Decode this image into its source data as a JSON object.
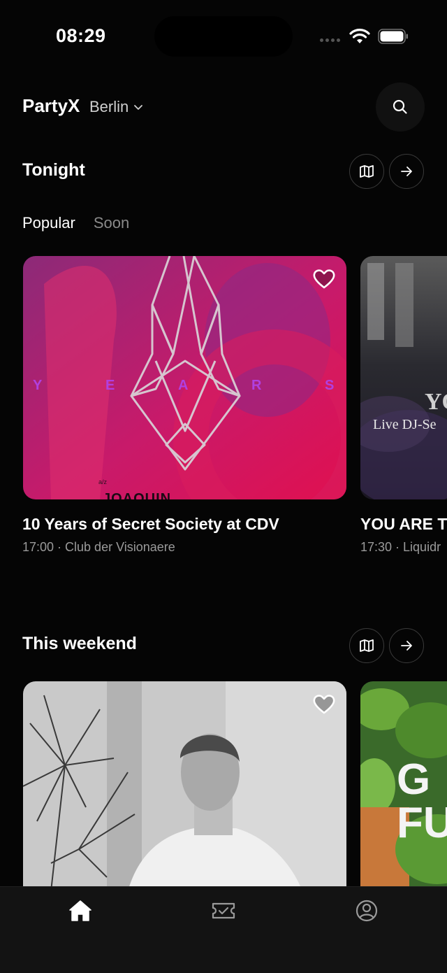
{
  "status_bar": {
    "time": "08:29"
  },
  "header": {
    "app_name": "PartyX",
    "city": "Berlin"
  },
  "sections": [
    {
      "title": "Tonight",
      "tabs": [
        {
          "label": "Popular",
          "active": true
        },
        {
          "label": "Soon",
          "active": false
        }
      ],
      "events": [
        {
          "title": "10 Years of Secret Society at CDV",
          "meta": "17:00 · Club der Visionaere",
          "poster_letters": [
            "Y",
            "E",
            "A",
            "R",
            "S"
          ],
          "poster_small": "a/z",
          "poster_name": "JOAQUIN"
        },
        {
          "title": "YOU ARE T",
          "meta": "17:30 · Liquidr",
          "poster_text": "Live DJ-Se",
          "poster_letters": "YO"
        }
      ]
    },
    {
      "title": "This weekend",
      "events": [
        {
          "title": "",
          "meta": ""
        },
        {
          "title": "",
          "meta": "",
          "poster_letters": [
            "G",
            "FU"
          ]
        }
      ]
    }
  ],
  "colors": {
    "background": "#050505",
    "poster_magenta": "#d4145a",
    "poster_purple": "#7a2e8c",
    "muted_text": "#9a9a9a"
  },
  "icons": {
    "map": "map-icon",
    "arrow": "arrow-right-icon",
    "heart": "heart-icon",
    "search": "search-icon",
    "home": "home-icon",
    "tickets": "ticket-icon",
    "profile": "profile-icon"
  }
}
